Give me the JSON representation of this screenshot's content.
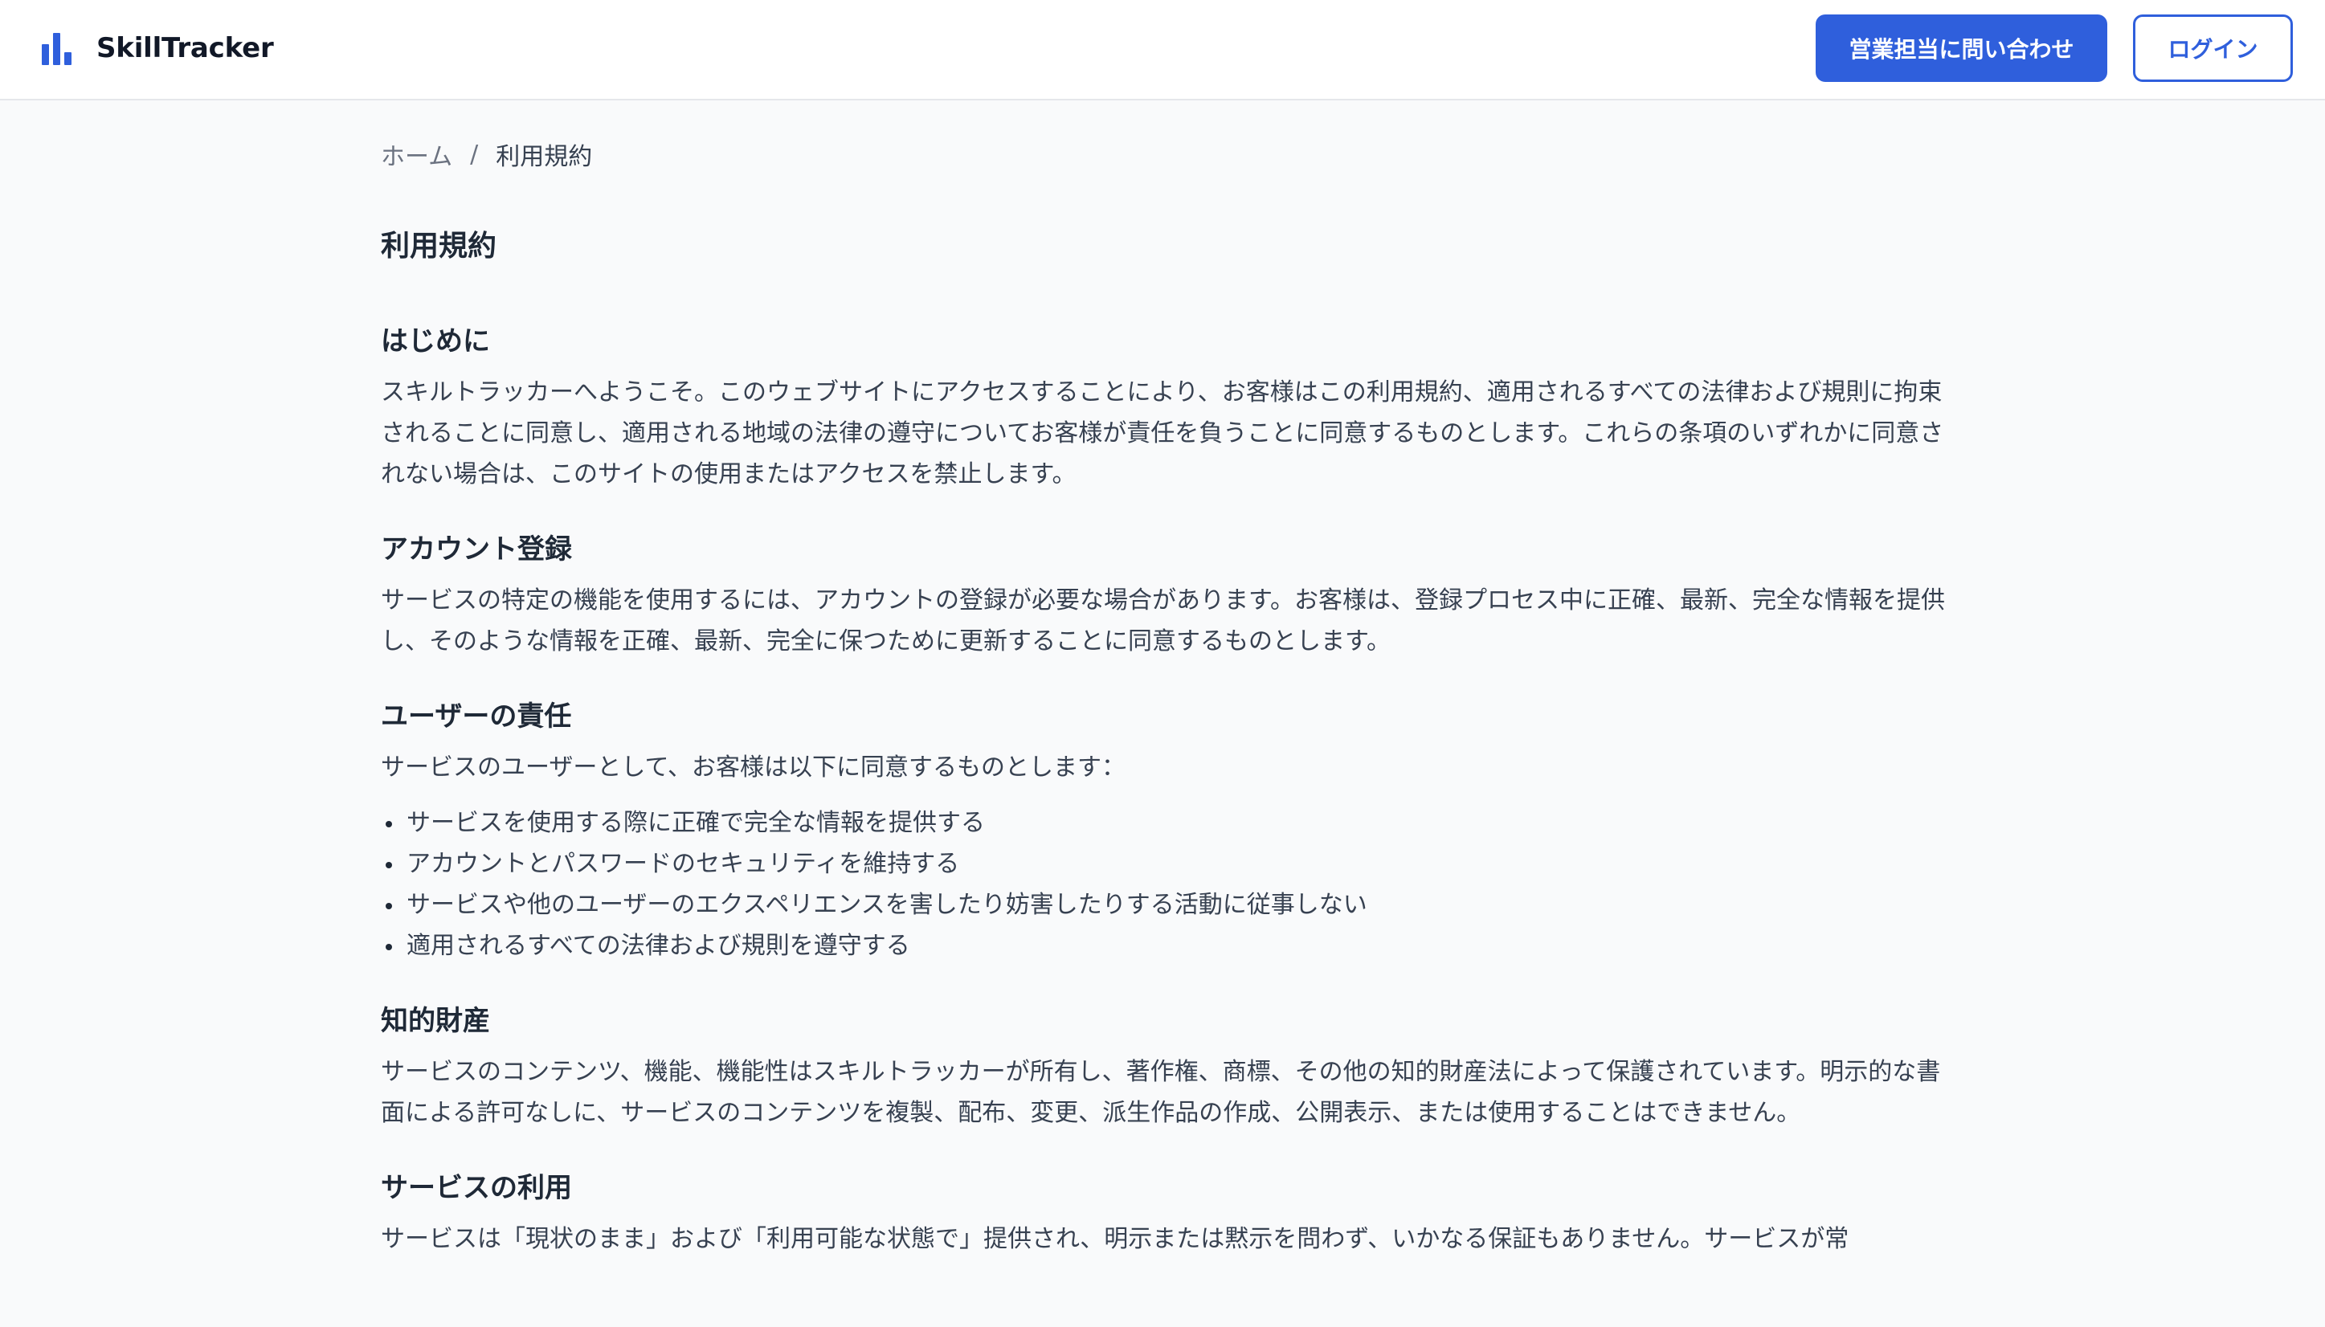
{
  "header": {
    "brand": "SkillTracker",
    "contact_label": "営業担当に問い合わせ",
    "login_label": "ログイン",
    "brand_color": "#2f5fdc"
  },
  "breadcrumb": {
    "home": "ホーム",
    "separator": "/",
    "current": "利用規約"
  },
  "page": {
    "title": "利用規約"
  },
  "sections": [
    {
      "heading": "はじめに",
      "body": "スキルトラッカーへようこそ。このウェブサイトにアクセスすることにより、お客様はこの利用規約、適用されるすべての法律および規則に拘束されることに同意し、適用される地域の法律の遵守についてお客様が責任を負うことに同意するものとします。これらの条項のいずれかに同意されない場合は、このサイトの使用またはアクセスを禁止します。"
    },
    {
      "heading": "アカウント登録",
      "body": "サービスの特定の機能を使用するには、アカウントの登録が必要な場合があります。お客様は、登録プロセス中に正確、最新、完全な情報を提供し、そのような情報を正確、最新、完全に保つために更新することに同意するものとします。"
    },
    {
      "heading": "ユーザーの責任",
      "body": "サービスのユーザーとして、お客様は以下に同意するものとします：",
      "items": [
        "サービスを使用する際に正確で完全な情報を提供する",
        "アカウントとパスワードのセキュリティを維持する",
        "サービスや他のユーザーのエクスペリエンスを害したり妨害したりする活動に従事しない",
        "適用されるすべての法律および規則を遵守する"
      ]
    },
    {
      "heading": "知的財産",
      "body": "サービスのコンテンツ、機能、機能性はスキルトラッカーが所有し、著作権、商標、その他の知的財産法によって保護されています。明示的な書面による許可なしに、サービスのコンテンツを複製、配布、変更、派生作品の作成、公開表示、または使用することはできません。"
    },
    {
      "heading": "サービスの利用",
      "body": "サービスは「現状のまま」および「利用可能な状態で」提供され、明示または黙示を問わず、いかなる保証もありません。サービスが常"
    }
  ]
}
